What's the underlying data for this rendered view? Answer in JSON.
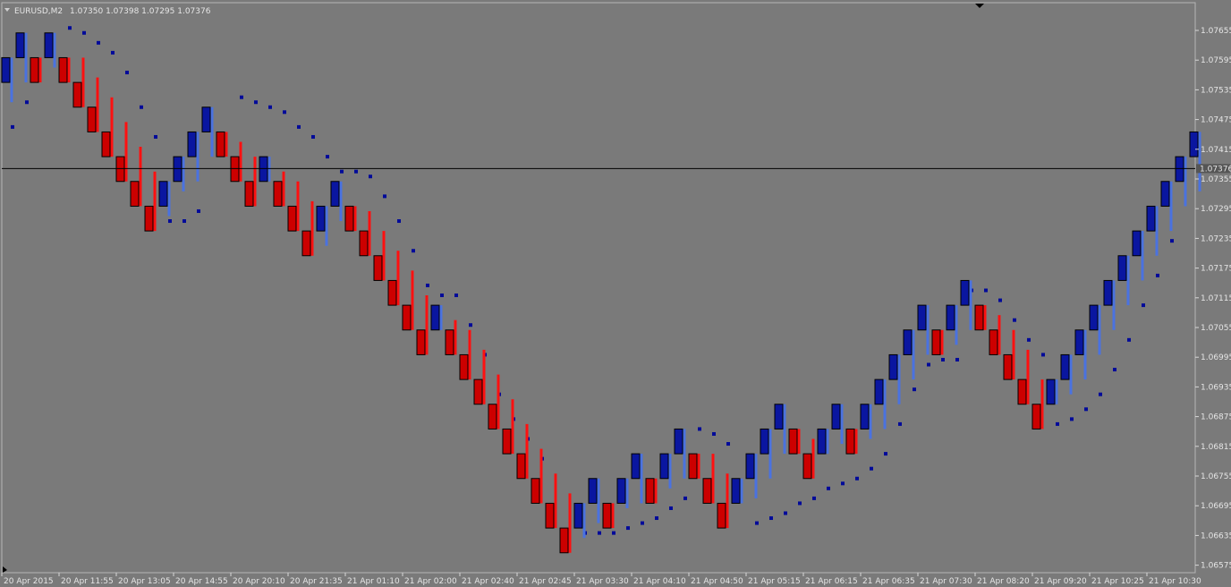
{
  "header": {
    "symbol_label": "EURUSD,M2",
    "ohlc_label": "1.07350 1.07398 1.07295 1.07376"
  },
  "colors": {
    "background": "#7a7a7a",
    "bull_body": "#0a16a0",
    "bull_wick": "#4a72e0",
    "bear_body": "#cc0000",
    "bear_wick": "#ff1010",
    "sar_dot": "#000a99",
    "price_line": "#000000",
    "axis_text": "#e6e6e6",
    "price_tag_bg": "#555555"
  },
  "chart_data": {
    "type": "candlestick",
    "price_line": 1.07376,
    "price_line_label": "1.07376",
    "ylim": [
      1.06555,
      1.07685
    ],
    "y_ticks": [
      "1.07655",
      "1.07595",
      "1.07535",
      "1.07475",
      "1.07415",
      "1.07355",
      "1.07295",
      "1.07235",
      "1.07175",
      "1.07115",
      "1.07055",
      "1.06995",
      "1.06935",
      "1.06875",
      "1.06815",
      "1.06755",
      "1.06695",
      "1.06635",
      "1.06575"
    ],
    "x_ticks": [
      "20 Apr 2015",
      "20 Apr 11:55",
      "20 Apr 13:05",
      "20 Apr 14:55",
      "20 Apr 20:10",
      "20 Apr 21:35",
      "21 Apr 01:10",
      "21 Apr 02:00",
      "21 Apr 02:40",
      "21 Apr 02:45",
      "21 Apr 03:30",
      "21 Apr 04:10",
      "21 Apr 04:50",
      "21 Apr 05:15",
      "21 Apr 06:15",
      "21 Apr 06:35",
      "21 Apr 07:30",
      "21 Apr 08:20",
      "21 Apr 09:20",
      "21 Apr 10:25",
      "21 Apr 10:30"
    ],
    "candles": [
      {
        "o": 1.0755,
        "c": 1.076,
        "h": 1.076,
        "l": 1.0751
      },
      {
        "o": 1.076,
        "c": 1.0765,
        "h": 1.0765,
        "l": 1.0755
      },
      {
        "o": 1.076,
        "c": 1.0755,
        "h": 1.076,
        "l": 1.0755
      },
      {
        "o": 1.076,
        "c": 1.0765,
        "h": 1.0765,
        "l": 1.0758
      },
      {
        "o": 1.076,
        "c": 1.0755,
        "h": 1.076,
        "l": 1.0755
      },
      {
        "o": 1.0755,
        "c": 1.075,
        "h": 1.076,
        "l": 1.075
      },
      {
        "o": 1.075,
        "c": 1.0745,
        "h": 1.0756,
        "l": 1.0745
      },
      {
        "o": 1.0745,
        "c": 1.074,
        "h": 1.0752,
        "l": 1.074
      },
      {
        "o": 1.074,
        "c": 1.0735,
        "h": 1.0747,
        "l": 1.0735
      },
      {
        "o": 1.0735,
        "c": 1.073,
        "h": 1.0742,
        "l": 1.073
      },
      {
        "o": 1.073,
        "c": 1.0725,
        "h": 1.0737,
        "l": 1.0725
      },
      {
        "o": 1.073,
        "c": 1.0735,
        "h": 1.0735,
        "l": 1.0728
      },
      {
        "o": 1.0735,
        "c": 1.074,
        "h": 1.074,
        "l": 1.0733
      },
      {
        "o": 1.074,
        "c": 1.0745,
        "h": 1.0745,
        "l": 1.0735
      },
      {
        "o": 1.0745,
        "c": 1.075,
        "h": 1.075,
        "l": 1.074
      },
      {
        "o": 1.0745,
        "c": 1.074,
        "h": 1.0745,
        "l": 1.074
      },
      {
        "o": 1.074,
        "c": 1.0735,
        "h": 1.0743,
        "l": 1.0735
      },
      {
        "o": 1.0735,
        "c": 1.073,
        "h": 1.074,
        "l": 1.073
      },
      {
        "o": 1.0735,
        "c": 1.074,
        "h": 1.074,
        "l": 1.0735
      },
      {
        "o": 1.0735,
        "c": 1.073,
        "h": 1.0737,
        "l": 1.073
      },
      {
        "o": 1.073,
        "c": 1.0725,
        "h": 1.0735,
        "l": 1.0725
      },
      {
        "o": 1.0725,
        "c": 1.072,
        "h": 1.0731,
        "l": 1.072
      },
      {
        "o": 1.0725,
        "c": 1.073,
        "h": 1.073,
        "l": 1.0722
      },
      {
        "o": 1.073,
        "c": 1.0735,
        "h": 1.0735,
        "l": 1.0727
      },
      {
        "o": 1.073,
        "c": 1.0725,
        "h": 1.073,
        "l": 1.0725
      },
      {
        "o": 1.0725,
        "c": 1.072,
        "h": 1.0729,
        "l": 1.072
      },
      {
        "o": 1.072,
        "c": 1.0715,
        "h": 1.0725,
        "l": 1.0715
      },
      {
        "o": 1.0715,
        "c": 1.071,
        "h": 1.0721,
        "l": 1.071
      },
      {
        "o": 1.071,
        "c": 1.0705,
        "h": 1.0717,
        "l": 1.0705
      },
      {
        "o": 1.0705,
        "c": 1.07,
        "h": 1.0712,
        "l": 1.07
      },
      {
        "o": 1.0705,
        "c": 1.071,
        "h": 1.071,
        "l": 1.0705
      },
      {
        "o": 1.0705,
        "c": 1.07,
        "h": 1.0707,
        "l": 1.07
      },
      {
        "o": 1.07,
        "c": 1.0695,
        "h": 1.0705,
        "l": 1.0695
      },
      {
        "o": 1.0695,
        "c": 1.069,
        "h": 1.0701,
        "l": 1.069
      },
      {
        "o": 1.069,
        "c": 1.0685,
        "h": 1.0696,
        "l": 1.0685
      },
      {
        "o": 1.0685,
        "c": 1.068,
        "h": 1.0691,
        "l": 1.068
      },
      {
        "o": 1.068,
        "c": 1.0675,
        "h": 1.0686,
        "l": 1.0675
      },
      {
        "o": 1.0675,
        "c": 1.067,
        "h": 1.0681,
        "l": 1.067
      },
      {
        "o": 1.067,
        "c": 1.0665,
        "h": 1.0676,
        "l": 1.0665
      },
      {
        "o": 1.0665,
        "c": 1.066,
        "h": 1.0672,
        "l": 1.066
      },
      {
        "o": 1.0665,
        "c": 1.067,
        "h": 1.067,
        "l": 1.0663
      },
      {
        "o": 1.067,
        "c": 1.0675,
        "h": 1.0675,
        "l": 1.0666
      },
      {
        "o": 1.067,
        "c": 1.0665,
        "h": 1.067,
        "l": 1.0665
      },
      {
        "o": 1.067,
        "c": 1.0675,
        "h": 1.0675,
        "l": 1.0669
      },
      {
        "o": 1.0675,
        "c": 1.068,
        "h": 1.068,
        "l": 1.067
      },
      {
        "o": 1.0675,
        "c": 1.067,
        "h": 1.0675,
        "l": 1.067
      },
      {
        "o": 1.0675,
        "c": 1.068,
        "h": 1.068,
        "l": 1.0673
      },
      {
        "o": 1.068,
        "c": 1.0685,
        "h": 1.0685,
        "l": 1.0675
      },
      {
        "o": 1.068,
        "c": 1.0675,
        "h": 1.068,
        "l": 1.0675
      },
      {
        "o": 1.0675,
        "c": 1.067,
        "h": 1.068,
        "l": 1.067
      },
      {
        "o": 1.067,
        "c": 1.0665,
        "h": 1.0676,
        "l": 1.0665
      },
      {
        "o": 1.067,
        "c": 1.0675,
        "h": 1.0675,
        "l": 1.067
      },
      {
        "o": 1.0675,
        "c": 1.068,
        "h": 1.068,
        "l": 1.0671
      },
      {
        "o": 1.068,
        "c": 1.0685,
        "h": 1.0685,
        "l": 1.0675
      },
      {
        "o": 1.0685,
        "c": 1.069,
        "h": 1.069,
        "l": 1.068
      },
      {
        "o": 1.0685,
        "c": 1.068,
        "h": 1.0685,
        "l": 1.068
      },
      {
        "o": 1.068,
        "c": 1.0675,
        "h": 1.0683,
        "l": 1.0675
      },
      {
        "o": 1.068,
        "c": 1.0685,
        "h": 1.0685,
        "l": 1.068
      },
      {
        "o": 1.0685,
        "c": 1.069,
        "h": 1.069,
        "l": 1.0682
      },
      {
        "o": 1.0685,
        "c": 1.068,
        "h": 1.0685,
        "l": 1.068
      },
      {
        "o": 1.0685,
        "c": 1.069,
        "h": 1.069,
        "l": 1.0683
      },
      {
        "o": 1.069,
        "c": 1.0695,
        "h": 1.0695,
        "l": 1.0685
      },
      {
        "o": 1.0695,
        "c": 1.07,
        "h": 1.07,
        "l": 1.069
      },
      {
        "o": 1.07,
        "c": 1.0705,
        "h": 1.0705,
        "l": 1.0695
      },
      {
        "o": 1.0705,
        "c": 1.071,
        "h": 1.071,
        "l": 1.07
      },
      {
        "o": 1.0705,
        "c": 1.07,
        "h": 1.0705,
        "l": 1.07
      },
      {
        "o": 1.0705,
        "c": 1.071,
        "h": 1.071,
        "l": 1.0702
      },
      {
        "o": 1.071,
        "c": 1.0715,
        "h": 1.0715,
        "l": 1.0705
      },
      {
        "o": 1.071,
        "c": 1.0705,
        "h": 1.071,
        "l": 1.0705
      },
      {
        "o": 1.0705,
        "c": 1.07,
        "h": 1.0708,
        "l": 1.07
      },
      {
        "o": 1.07,
        "c": 1.0695,
        "h": 1.0705,
        "l": 1.0695
      },
      {
        "o": 1.0695,
        "c": 1.069,
        "h": 1.0701,
        "l": 1.069
      },
      {
        "o": 1.069,
        "c": 1.0685,
        "h": 1.0695,
        "l": 1.0685
      },
      {
        "o": 1.069,
        "c": 1.0695,
        "h": 1.0695,
        "l": 1.069
      },
      {
        "o": 1.0695,
        "c": 1.07,
        "h": 1.07,
        "l": 1.0692
      },
      {
        "o": 1.07,
        "c": 1.0705,
        "h": 1.0705,
        "l": 1.0695
      },
      {
        "o": 1.0705,
        "c": 1.071,
        "h": 1.071,
        "l": 1.07
      },
      {
        "o": 1.071,
        "c": 1.0715,
        "h": 1.0715,
        "l": 1.0705
      },
      {
        "o": 1.0715,
        "c": 1.072,
        "h": 1.072,
        "l": 1.071
      },
      {
        "o": 1.072,
        "c": 1.0725,
        "h": 1.0725,
        "l": 1.0715
      },
      {
        "o": 1.0725,
        "c": 1.073,
        "h": 1.073,
        "l": 1.072
      },
      {
        "o": 1.073,
        "c": 1.0735,
        "h": 1.0735,
        "l": 1.0725
      },
      {
        "o": 1.0735,
        "c": 1.074,
        "h": 1.074,
        "l": 1.073
      },
      {
        "o": 1.074,
        "c": 1.0745,
        "h": 1.0745,
        "l": 1.0733
      }
    ],
    "sar": [
      {
        "i": -0.5,
        "v": 1.0743
      },
      {
        "i": 0.5,
        "v": 1.0746
      },
      {
        "i": 1.5,
        "v": 1.0751
      },
      {
        "i": 4.5,
        "v": 1.0766
      },
      {
        "i": 5.5,
        "v": 1.0765
      },
      {
        "i": 6.5,
        "v": 1.0763
      },
      {
        "i": 7.5,
        "v": 1.0761
      },
      {
        "i": 8.5,
        "v": 1.0757
      },
      {
        "i": 9.5,
        "v": 1.075
      },
      {
        "i": 10.5,
        "v": 1.0744
      },
      {
        "i": 11.5,
        "v": 1.0727
      },
      {
        "i": 12.5,
        "v": 1.0727
      },
      {
        "i": 13.5,
        "v": 1.0729
      },
      {
        "i": 16.5,
        "v": 1.0752
      },
      {
        "i": 17.5,
        "v": 1.0751
      },
      {
        "i": 18.5,
        "v": 1.075
      },
      {
        "i": 19.5,
        "v": 1.0749
      },
      {
        "i": 20.5,
        "v": 1.0746
      },
      {
        "i": 21.5,
        "v": 1.0744
      },
      {
        "i": 22.5,
        "v": 1.074
      },
      {
        "i": 23.5,
        "v": 1.0737
      },
      {
        "i": 24.5,
        "v": 1.0737
      },
      {
        "i": 25.5,
        "v": 1.0736
      },
      {
        "i": 26.5,
        "v": 1.0732
      },
      {
        "i": 27.5,
        "v": 1.0727
      },
      {
        "i": 28.5,
        "v": 1.0721
      },
      {
        "i": 29.5,
        "v": 1.0714
      },
      {
        "i": 30.5,
        "v": 1.0712
      },
      {
        "i": 31.5,
        "v": 1.0712
      },
      {
        "i": 32.5,
        "v": 1.0706
      },
      {
        "i": 33.5,
        "v": 1.07
      },
      {
        "i": 34.5,
        "v": 1.0692
      },
      {
        "i": 35.5,
        "v": 1.0687
      },
      {
        "i": 36.5,
        "v": 1.0683
      },
      {
        "i": 37.5,
        "v": 1.0679
      },
      {
        "i": 40.5,
        "v": 1.0664
      },
      {
        "i": 41.5,
        "v": 1.0664
      },
      {
        "i": 42.5,
        "v": 1.0664
      },
      {
        "i": 43.5,
        "v": 1.0665
      },
      {
        "i": 44.5,
        "v": 1.0666
      },
      {
        "i": 45.5,
        "v": 1.0667
      },
      {
        "i": 46.5,
        "v": 1.0669
      },
      {
        "i": 47.5,
        "v": 1.0671
      },
      {
        "i": 48.5,
        "v": 1.0685
      },
      {
        "i": 49.5,
        "v": 1.0684
      },
      {
        "i": 50.5,
        "v": 1.0682
      },
      {
        "i": 52.5,
        "v": 1.0666
      },
      {
        "i": 53.5,
        "v": 1.0667
      },
      {
        "i": 54.5,
        "v": 1.0668
      },
      {
        "i": 55.5,
        "v": 1.067
      },
      {
        "i": 56.5,
        "v": 1.0671
      },
      {
        "i": 57.5,
        "v": 1.0673
      },
      {
        "i": 58.5,
        "v": 1.0674
      },
      {
        "i": 59.5,
        "v": 1.0675
      },
      {
        "i": 60.5,
        "v": 1.0677
      },
      {
        "i": 61.5,
        "v": 1.068
      },
      {
        "i": 62.5,
        "v": 1.0686
      },
      {
        "i": 63.5,
        "v": 1.0693
      },
      {
        "i": 64.5,
        "v": 1.0698
      },
      {
        "i": 65.5,
        "v": 1.0699
      },
      {
        "i": 66.5,
        "v": 1.0699
      },
      {
        "i": 67.5,
        "v": 1.0713
      },
      {
        "i": 68.5,
        "v": 1.0713
      },
      {
        "i": 69.5,
        "v": 1.0711
      },
      {
        "i": 70.5,
        "v": 1.0707
      },
      {
        "i": 71.5,
        "v": 1.0703
      },
      {
        "i": 72.5,
        "v": 1.07
      },
      {
        "i": 73.5,
        "v": 1.0686
      },
      {
        "i": 74.5,
        "v": 1.0687
      },
      {
        "i": 75.5,
        "v": 1.0689
      },
      {
        "i": 76.5,
        "v": 1.0692
      },
      {
        "i": 77.5,
        "v": 1.0697
      },
      {
        "i": 78.5,
        "v": 1.0703
      },
      {
        "i": 79.5,
        "v": 1.071
      },
      {
        "i": 80.5,
        "v": 1.0716
      },
      {
        "i": 81.5,
        "v": 1.0723
      }
    ],
    "title": "",
    "xlabel": "",
    "ylabel": "",
    "grid": false
  }
}
